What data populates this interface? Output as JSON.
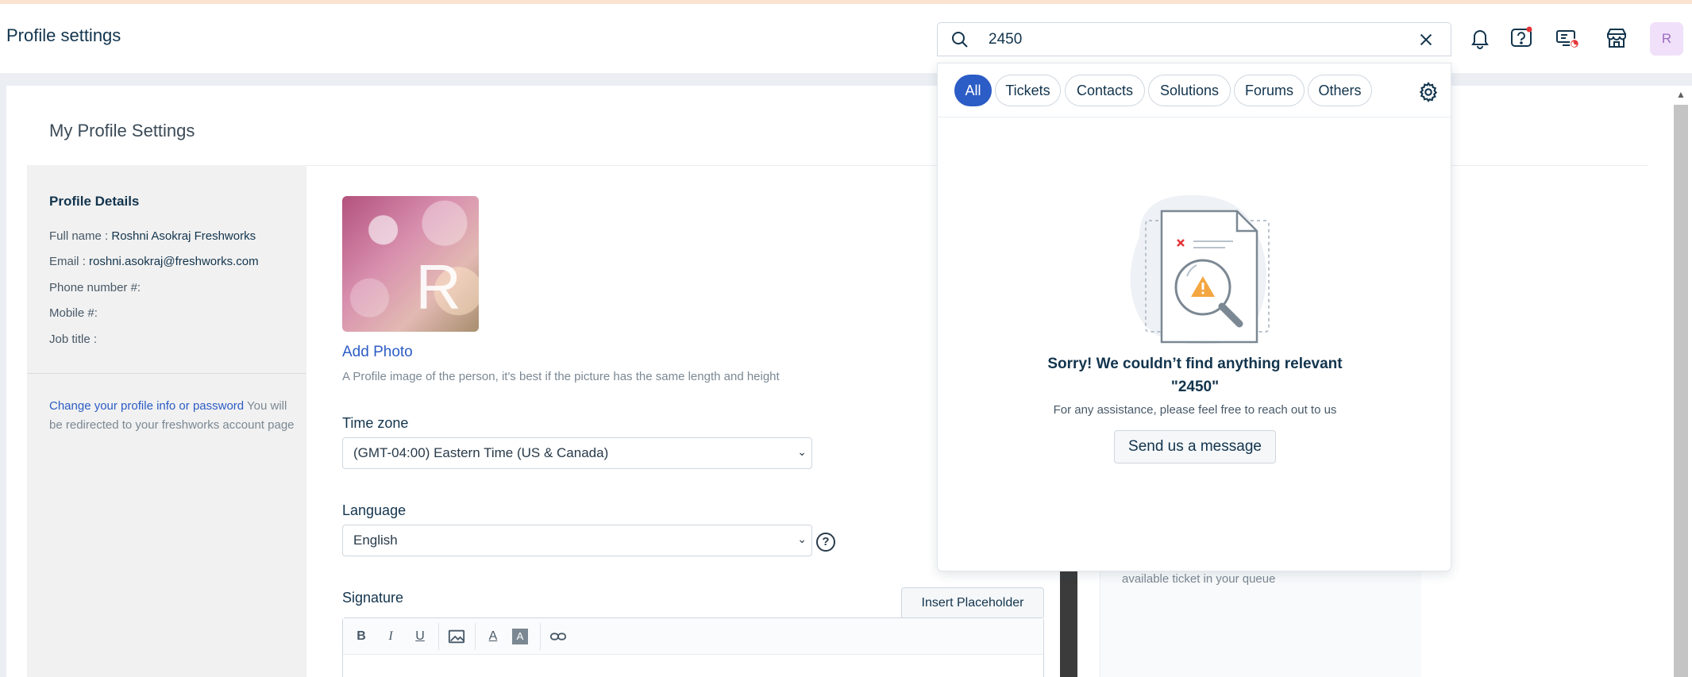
{
  "header": {
    "title": "Profile settings",
    "avatar_initial": "R"
  },
  "search": {
    "value": "2450",
    "tabs": [
      {
        "label": "All",
        "active": true
      },
      {
        "label": "Tickets",
        "active": false
      },
      {
        "label": "Contacts",
        "active": false
      },
      {
        "label": "Solutions",
        "active": false
      },
      {
        "label": "Forums",
        "active": false
      },
      {
        "label": "Others",
        "active": false
      }
    ],
    "empty_title_line1": "Sorry! We couldn’t find anything relevant",
    "empty_title_line2": "\"2450\"",
    "empty_hint": "For any assistance, please feel free to reach out to us",
    "send_message_label": "Send us a message"
  },
  "profile": {
    "section_title": "My Profile Settings",
    "details_title": "Profile Details",
    "fields": [
      {
        "label": "Full name : ",
        "value": "Roshni Asokraj Freshworks"
      },
      {
        "label": "Email : ",
        "value": "roshni.asokraj@freshworks.com"
      },
      {
        "label": "Phone number #:",
        "value": ""
      },
      {
        "label": "Mobile #:",
        "value": ""
      },
      {
        "label": "Job title :",
        "value": ""
      }
    ],
    "change_link": "Change your profile info or password",
    "change_note": " You will be redirected to your freshworks account page",
    "photo_letter": "R",
    "add_photo": "Add Photo",
    "photo_hint": "A Profile image of the person, it's best if the picture has the same length and height",
    "timezone_label": "Time zone",
    "timezone_value": "(GMT-04:00) Eastern Time (US & Canada)",
    "language_label": "Language",
    "language_value": "English",
    "signature_label": "Signature",
    "insert_placeholder": "Insert Placeholder",
    "queue_text": "available ticket in your queue"
  },
  "colors": {
    "accent": "#2c5cc5",
    "notification_dot": "#e43538"
  }
}
